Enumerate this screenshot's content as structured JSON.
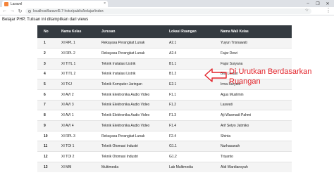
{
  "browser": {
    "tab_title": "Laravel",
    "tab_close": "×",
    "url": "localhost/laravel5.7-hotrz/public/belajar/index",
    "window_controls": [
      "–",
      "❐",
      "✕"
    ],
    "nav": {
      "back": "←",
      "forward": "→",
      "reload": "↻"
    },
    "star": "☆",
    "menu": "⋮"
  },
  "page": {
    "intro": "Belajar PHP, Tulisan ini ditampilkan dari views"
  },
  "table": {
    "headers": [
      "No",
      "Nama Kelas",
      "Jurusan",
      "Lokasi Ruangan",
      "Nama Wali Kelas"
    ],
    "rows": [
      [
        "1",
        "XI RPL 1",
        "Rekayasa Perangkat Lunak",
        "A2.1",
        "Yuyun Trisnawati"
      ],
      [
        "2",
        "XI RPL 2",
        "Rekayasa Perangkat Lunak",
        "A2.4",
        "Fajar Dewi"
      ],
      [
        "3",
        "XI TITL 1",
        "Teknik Instalasi Listrik",
        "B1.1",
        "Fajar Suryana"
      ],
      [
        "4",
        "XI TITL 2",
        "Teknik Instalasi Listrik",
        "B1.2",
        "Bila Lestari"
      ],
      [
        "5",
        "XI TKJ",
        "Teknik Komputer Jaringan",
        "E2.1",
        "Irma Suryani"
      ],
      [
        "6",
        "XI AVI 2",
        "Teknik Elektronika Audio Video",
        "F1.1",
        "Agus Muslimin"
      ],
      [
        "7",
        "XI AVI 3",
        "Teknik Elektronika Audio Video",
        "F1.2",
        "Laswati"
      ],
      [
        "8",
        "XI AVI 1",
        "Teknik Elektronika Audio Video",
        "F1.3",
        "Aji Wasmadi Pahmi"
      ],
      [
        "9",
        "XI AVI 4",
        "Teknik Elektronika Audio Video",
        "F1.4",
        "Arif Setyo Jatmiko"
      ],
      [
        "10",
        "XI RPL 3",
        "Rekayasa Perangkat Lunak",
        "F2.4",
        "Shinta"
      ],
      [
        "11",
        "XI TOI 1",
        "Teknik Otomasi Industri",
        "G1.1",
        "Nurhasanah"
      ],
      [
        "12",
        "XI TOI 2",
        "Teknik Otomasi Industri",
        "G1.2",
        "Triyanto"
      ],
      [
        "13",
        "XI MM",
        "Multimedia",
        "Lab Multimedia",
        "Aldi Wardiansyah"
      ]
    ]
  },
  "annotation": {
    "line1": "Di Urutkan Berdasarkan",
    "line2": "Ruangan",
    "color": "#e3242b"
  }
}
